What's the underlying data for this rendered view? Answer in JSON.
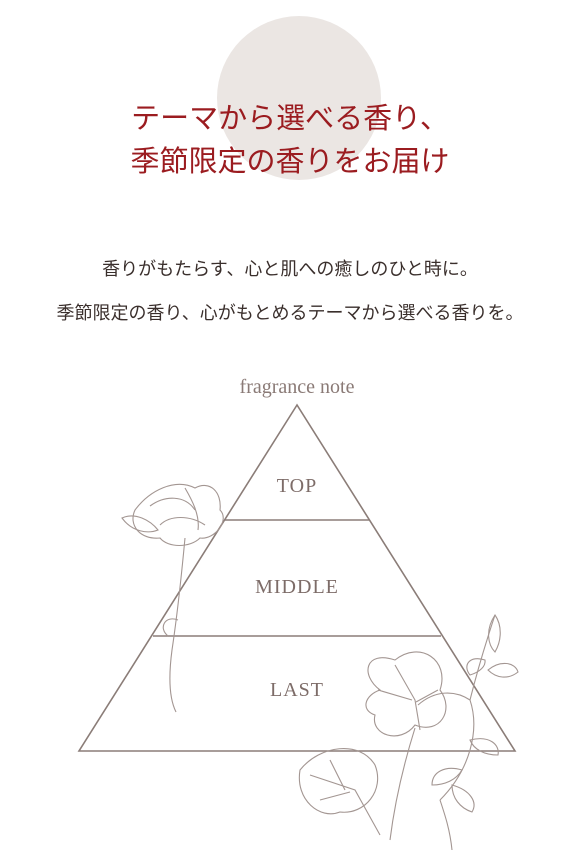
{
  "header": {
    "title_line1": "テーマから選べる香り、",
    "title_line2": "季節限定の香りをお届け",
    "accent_color": "#9b1c20",
    "circle_color": "#ebe6e3"
  },
  "intro": {
    "line1": "香りがもたらす、心と肌への癒しのひと時に。",
    "line2": "季節限定の香り、心がもとめるテーマから選べる香りを。"
  },
  "pyramid": {
    "label": "fragrance note",
    "tiers": [
      "TOP",
      "MIDDLE",
      "LAST"
    ],
    "line_color": "#8b7d78"
  }
}
